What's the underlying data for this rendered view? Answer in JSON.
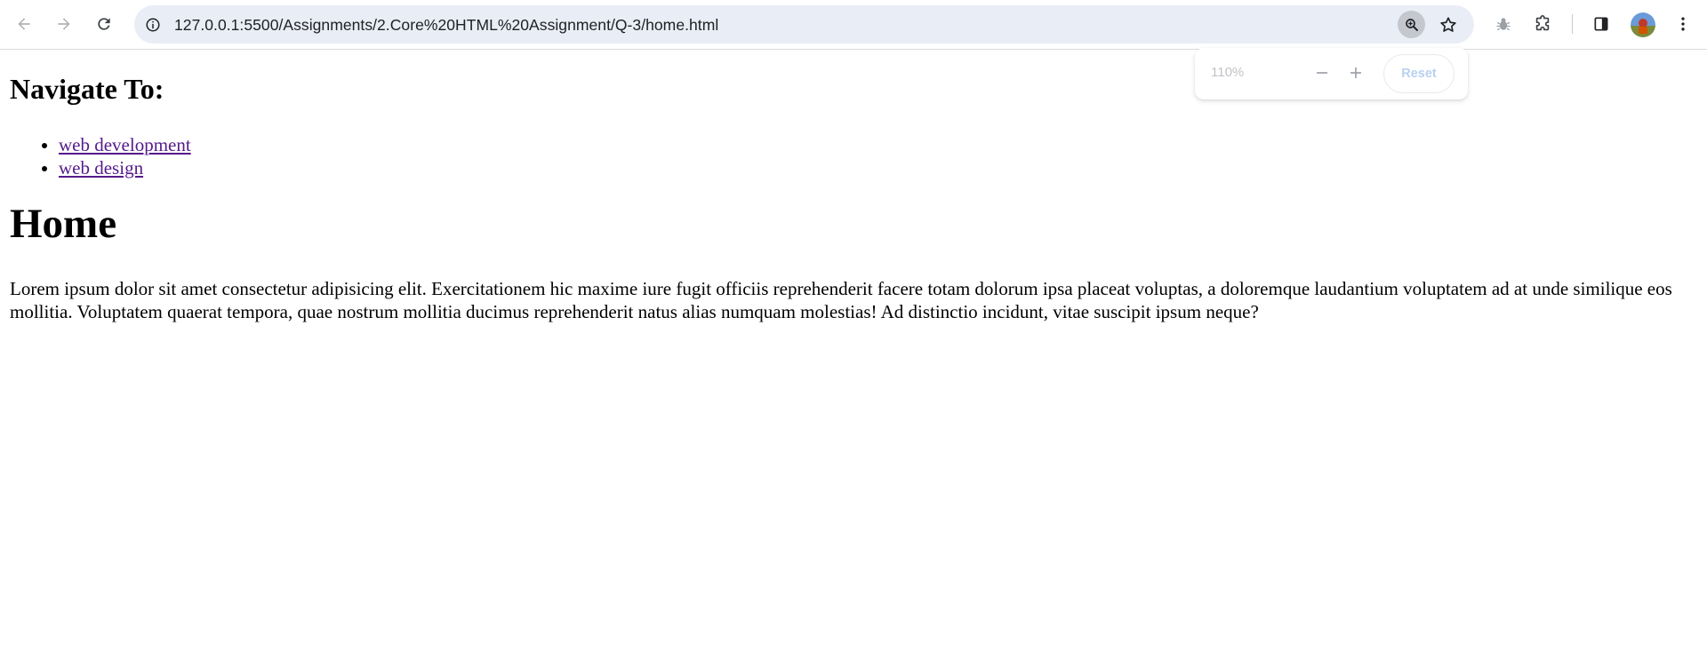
{
  "browser": {
    "url": "127.0.0.1:5500/Assignments/2.Core%20HTML%20Assignment/Q-3/home.html",
    "icons": [
      "back-arrow-icon",
      "forward-arrow-icon",
      "reload-icon",
      "site-info-icon",
      "zoom-icon",
      "star-icon",
      "bug-extension-icon",
      "extensions-puzzle-icon",
      "side-panel-icon",
      "profile-avatar",
      "more-vert-icon"
    ],
    "zoom_popup": {
      "level": "110%",
      "minus_label": "−",
      "plus_label": "+",
      "reset_label": "Reset"
    }
  },
  "page": {
    "nav_heading": "Navigate To:",
    "nav_links": [
      {
        "label": "web development"
      },
      {
        "label": "web design"
      }
    ],
    "title": "Home",
    "paragraph": "Lorem ipsum dolor sit amet consectetur adipisicing elit. Exercitationem hic maxime iure fugit officiis reprehenderit facere totam dolorum ipsa placeat voluptas, a doloremque laudantium voluptatem ad at unde similique eos mollitia. Voluptatem quaerat tempora, quae nostrum mollitia ducimus reprehenderit natus alias numquam molestias! Ad distinctio incidunt, vitae suscipit ipsum neque?"
  },
  "colors": {
    "omnibox_bg": "#e9edf6",
    "visited_link": "#551a8b",
    "reset_text": "#b9d1f1"
  }
}
